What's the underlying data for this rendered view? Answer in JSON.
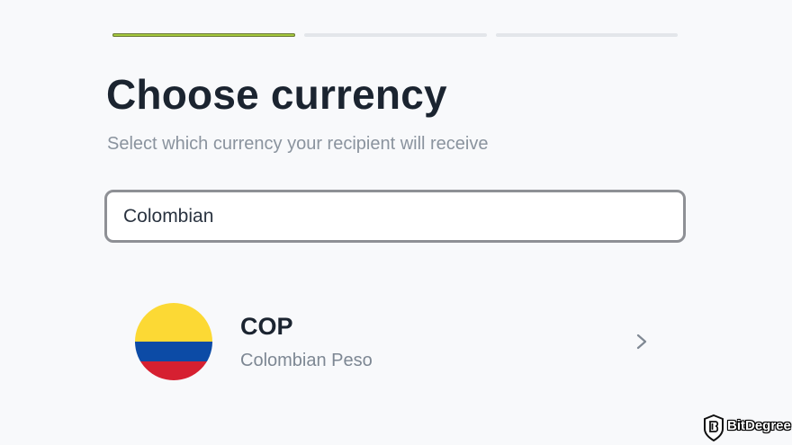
{
  "progress": {
    "total_steps": 3,
    "current_step": 1
  },
  "header": {
    "title": "Choose currency",
    "subtitle": "Select which currency your recipient will receive"
  },
  "search": {
    "value": "Colombian"
  },
  "results": [
    {
      "code": "COP",
      "name": "Colombian Peso",
      "flag_icon": "colombia-flag-icon",
      "flag_colors": [
        "#fcd934",
        "#0c4ba6",
        "#d62031"
      ]
    }
  ],
  "watermark": {
    "brand": "BitDegree",
    "logo_icon": "bitdegree-shield-icon"
  },
  "colors": {
    "accent": "#a4c83c",
    "text_primary": "#1b2430",
    "text_secondary": "#8a939e"
  }
}
